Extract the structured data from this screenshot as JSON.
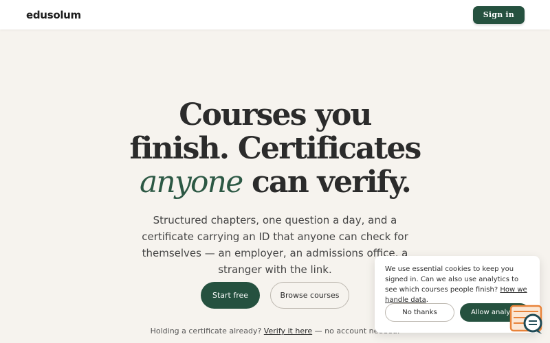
{
  "header": {
    "logo": "edusolum",
    "signin_label": "Sign in"
  },
  "hero": {
    "title_line1": "Courses you",
    "title_line2": "finish. Certificates",
    "title_line3_accent": "anyone",
    "title_line3_rest": " can verify.",
    "subtitle": "Structured chapters, one question a day, and a certificate carrying an ID that anyone can check for themselves — an employer, an admissions office, a stranger with the link."
  },
  "cta": {
    "primary_label": "Start free",
    "secondary_label": "Browse courses"
  },
  "verify": {
    "prefix": "Holding a certificate already?",
    "link": "Verify it here",
    "suffix": "— no account needed."
  },
  "cookie": {
    "text_before_link": "We use essential cookies to keep you signed in. Can we also use analytics to see which courses people finish?",
    "link": "How we handle data",
    "text_after_link": ".",
    "reject_label": "No thanks",
    "accept_label": "Allow analytics"
  },
  "colors": {
    "brand": "#25513f",
    "accent_text": "#2c5844",
    "background": "#f6f3ee",
    "chat_widget_orange": "#e8833a",
    "chat_widget_teal": "#1f4a55"
  },
  "icons": {
    "chat_widget": "chat-bubble-icon"
  }
}
